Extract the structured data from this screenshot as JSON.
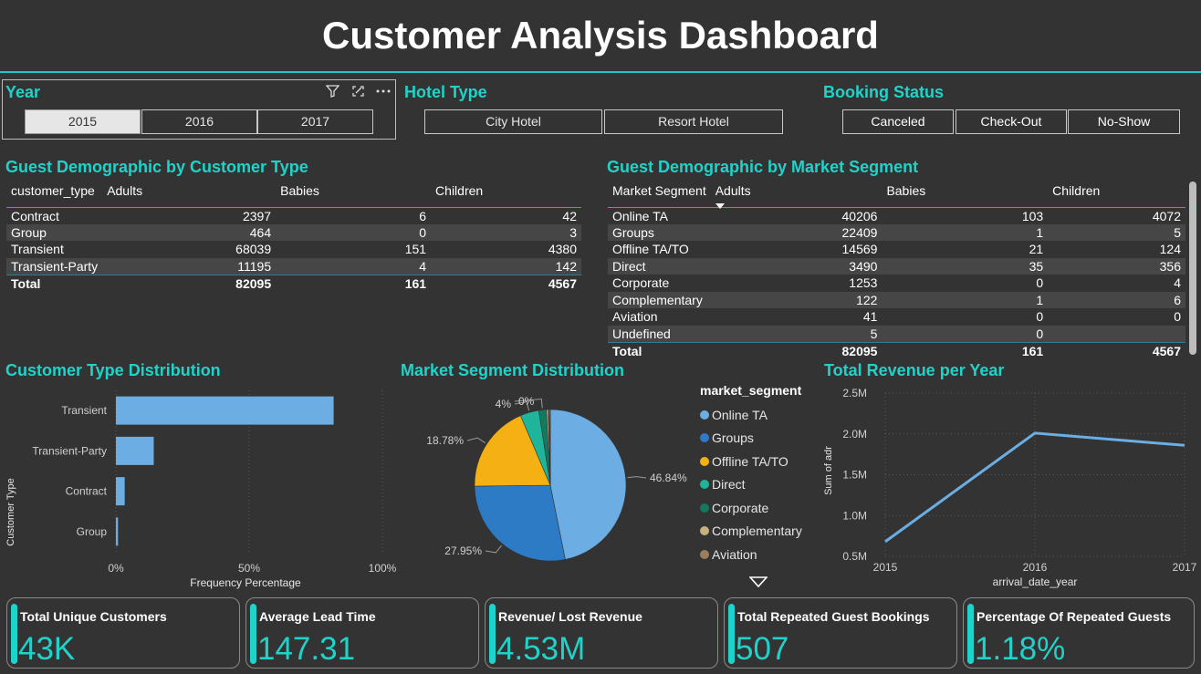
{
  "title": "Customer Analysis Dashboard",
  "colors": {
    "accent": "#20d3ca",
    "bar": "#6caee3",
    "line": "#6caee3"
  },
  "slicers": {
    "year": {
      "title": "Year",
      "options": [
        "2015",
        "2016",
        "2017"
      ],
      "selected": "2015"
    },
    "hotel_type": {
      "title": "Hotel Type",
      "options": [
        "City Hotel",
        "Resort Hotel"
      ]
    },
    "booking_status": {
      "title": "Booking Status",
      "options": [
        "Canceled",
        "Check-Out",
        "No-Show"
      ]
    }
  },
  "customer_table": {
    "title": "Guest Demographic by Customer Type",
    "columns": [
      "customer_type",
      "Adults",
      "Babies",
      "Children"
    ],
    "rows": [
      [
        "Contract",
        "2397",
        "6",
        "42"
      ],
      [
        "Group",
        "464",
        "0",
        "3"
      ],
      [
        "Transient",
        "68039",
        "151",
        "4380"
      ],
      [
        "Transient-Party",
        "11195",
        "4",
        "142"
      ]
    ],
    "total": [
      "Total",
      "82095",
      "161",
      "4567"
    ]
  },
  "segment_table": {
    "title": "Guest Demographic by Market Segment",
    "columns": [
      "Market Segment",
      "Adults",
      "Babies",
      "Children"
    ],
    "rows": [
      [
        "Online TA",
        "40206",
        "103",
        "4072"
      ],
      [
        "Groups",
        "22409",
        "1",
        "5"
      ],
      [
        "Offline TA/TO",
        "14569",
        "21",
        "124"
      ],
      [
        "Direct",
        "3490",
        "35",
        "356"
      ],
      [
        "Corporate",
        "1253",
        "0",
        "4"
      ],
      [
        "Complementary",
        "122",
        "1",
        "6"
      ],
      [
        "Aviation",
        "41",
        "0",
        "0"
      ],
      [
        "Undefined",
        "5",
        "0",
        ""
      ]
    ],
    "total": [
      "Total",
      "82095",
      "161",
      "4567"
    ]
  },
  "chart_data": [
    {
      "type": "bar",
      "title": "Customer Type Distribution",
      "orientation": "horizontal",
      "categories": [
        "Transient",
        "Transient-Party",
        "Contract",
        "Group"
      ],
      "values": [
        81.7,
        14.2,
        3.3,
        0.8
      ],
      "xlabel": "Frequency Percentage",
      "ylabel": "Customer Type",
      "xlim": [
        0,
        100
      ],
      "xticks": [
        "0%",
        "50%",
        "100%"
      ],
      "grid": true
    },
    {
      "type": "pie",
      "title": "Market Segment Distribution",
      "legend_title": "market_segment",
      "legend_placement": "right",
      "series": [
        {
          "name": "Online TA",
          "value": 46.84,
          "color": "#6caee3"
        },
        {
          "name": "Groups",
          "value": 27.95,
          "color": "#2c7bc4"
        },
        {
          "name": "Offline TA/TO",
          "value": 18.78,
          "color": "#f5b014"
        },
        {
          "name": "Direct",
          "value": 4.0,
          "color": "#1fb59a"
        },
        {
          "name": "Corporate",
          "value": 1.6,
          "color": "#14795f"
        },
        {
          "name": "Complementary",
          "value": 0.4,
          "color": "#c8b07c"
        },
        {
          "name": "Aviation",
          "value": 0.2,
          "color": "#9a7c5e"
        },
        {
          "name": "",
          "value": 0.23,
          "color": "#6f6f6f"
        }
      ],
      "data_labels": [
        "46.84%",
        "27.95%",
        "18.78%",
        "4%",
        "0%"
      ]
    },
    {
      "type": "line",
      "title": "Total Revenue per Year",
      "x": [
        "2015",
        "2016",
        "2017"
      ],
      "y": [
        0.68,
        2.01,
        1.86
      ],
      "xlabel": "arrival_date_year",
      "ylabel": "Sum of adr",
      "ylim": [
        0.5,
        2.5
      ],
      "yticks": [
        "0.5M",
        "1.0M",
        "1.5M",
        "2.0M",
        "2.5M"
      ],
      "grid": true
    }
  ],
  "cards": [
    {
      "title": "Total Unique Customers",
      "value": "43K"
    },
    {
      "title": "Average Lead Time",
      "value": "147.31"
    },
    {
      "title": "Revenue/ Lost Revenue",
      "value": "4.53M"
    },
    {
      "title": "Total Repeated Guest Bookings",
      "value": "507"
    },
    {
      "title": "Percentage Of Repeated Guests",
      "value": "1.18%"
    }
  ]
}
